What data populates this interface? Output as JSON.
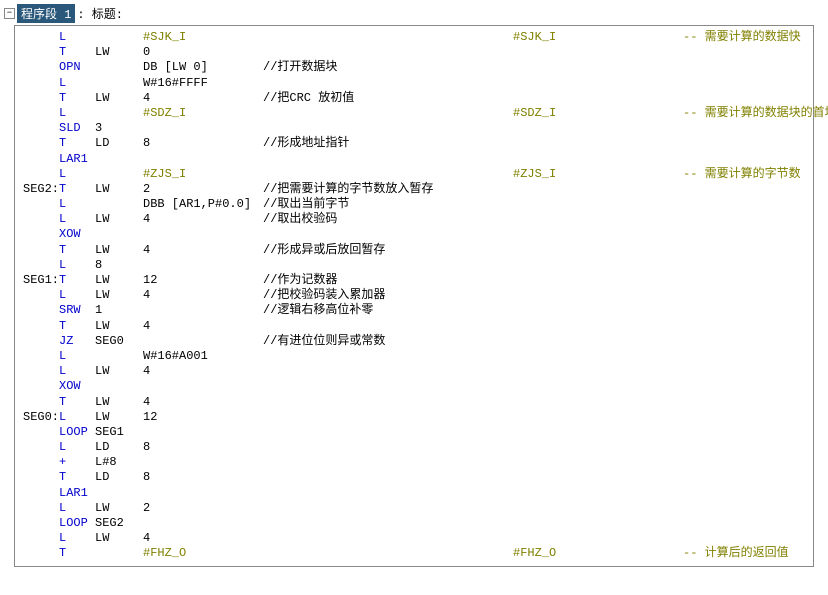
{
  "header": {
    "segment": "程序段 1",
    "title_label": ": 标题:"
  },
  "lines": [
    {
      "label": "",
      "op": "L",
      "arg1": "",
      "arg2": "#SJK_I",
      "argClass": "sharp",
      "comment": "",
      "refvar": "#SJK_I",
      "refcomment": "-- 需要计算的数据快"
    },
    {
      "label": "",
      "op": "T",
      "arg1": "LW",
      "arg2": "0",
      "comment": ""
    },
    {
      "label": "",
      "op": "OPN",
      "arg1": "",
      "arg2": "DB [LW 0]",
      "comment": "//打开数据块"
    },
    {
      "label": "",
      "op": "L",
      "arg1": "",
      "arg2": "W#16#FFFF",
      "comment": ""
    },
    {
      "label": "",
      "op": "T",
      "arg1": "LW",
      "arg2": "4",
      "comment": "//把CRC 放初值"
    },
    {
      "label": "",
      "op": "L",
      "arg1": "",
      "arg2": "#SDZ_I",
      "argClass": "sharp",
      "comment": "",
      "refvar": "#SDZ_I",
      "refcomment": "-- 需要计算的数据块的首地址"
    },
    {
      "label": "",
      "op": "SLD",
      "arg1": "3",
      "arg2": "",
      "comment": ""
    },
    {
      "label": "",
      "op": "T",
      "arg1": "LD",
      "arg2": "8",
      "comment": "//形成地址指针"
    },
    {
      "label": "",
      "op": "LAR1",
      "arg1": "",
      "arg2": "",
      "comment": ""
    },
    {
      "label": "",
      "op": "L",
      "arg1": "",
      "arg2": "#ZJS_I",
      "argClass": "sharp",
      "comment": "",
      "refvar": "#ZJS_I",
      "refcomment": "-- 需要计算的字节数"
    },
    {
      "label": "SEG2:",
      "op": "T",
      "arg1": "LW",
      "arg2": "2",
      "comment": "//把需要计算的字节数放入暂存"
    },
    {
      "label": "",
      "op": "L",
      "arg1": "",
      "arg2": "DBB [AR1,P#0.0]",
      "comment": "//取出当前字节"
    },
    {
      "label": "",
      "op": "L",
      "arg1": "LW",
      "arg2": "4",
      "comment": "//取出校验码"
    },
    {
      "label": "",
      "op": "XOW",
      "arg1": "",
      "arg2": "",
      "comment": ""
    },
    {
      "label": "",
      "op": "T",
      "arg1": "LW",
      "arg2": "4",
      "comment": "//形成异或后放回暂存"
    },
    {
      "label": "",
      "op": "L",
      "arg1": "8",
      "arg2": "",
      "comment": ""
    },
    {
      "label": "SEG1:",
      "op": "T",
      "arg1": "LW",
      "arg2": "12",
      "comment": "//作为记数器"
    },
    {
      "label": "",
      "op": "L",
      "arg1": "LW",
      "arg2": "4",
      "comment": "//把校验码装入累加器"
    },
    {
      "label": "",
      "op": "SRW",
      "arg1": "1",
      "arg2": "",
      "comment": "//逻辑右移高位补零"
    },
    {
      "label": "",
      "op": "T",
      "arg1": "LW",
      "arg2": "4",
      "comment": ""
    },
    {
      "label": "",
      "op": "JZ",
      "arg1": "SEG0",
      "arg2": "",
      "comment": "//有进位位则异或常数"
    },
    {
      "label": "",
      "op": "L",
      "arg1": "",
      "arg2": "W#16#A001",
      "comment": ""
    },
    {
      "label": "",
      "op": "L",
      "arg1": "LW",
      "arg2": "4",
      "comment": ""
    },
    {
      "label": "",
      "op": "XOW",
      "arg1": "",
      "arg2": "",
      "comment": ""
    },
    {
      "label": "",
      "op": "T",
      "arg1": "LW",
      "arg2": "4",
      "comment": ""
    },
    {
      "label": "SEG0:",
      "op": "L",
      "arg1": "LW",
      "arg2": "12",
      "comment": ""
    },
    {
      "label": "",
      "op": "LOOP",
      "arg1": "SEG1",
      "arg2": "",
      "comment": ""
    },
    {
      "label": "",
      "op": "L",
      "arg1": "LD",
      "arg2": "8",
      "comment": ""
    },
    {
      "label": "",
      "op": "+",
      "arg1": "L#8",
      "arg2": "",
      "comment": ""
    },
    {
      "label": "",
      "op": "T",
      "arg1": "LD",
      "arg2": "8",
      "comment": ""
    },
    {
      "label": "",
      "op": "LAR1",
      "arg1": "",
      "arg2": "",
      "comment": ""
    },
    {
      "label": "",
      "op": "L",
      "arg1": "LW",
      "arg2": "2",
      "comment": ""
    },
    {
      "label": "",
      "op": "LOOP",
      "arg1": "SEG2",
      "arg2": "",
      "comment": ""
    },
    {
      "label": "",
      "op": "L",
      "arg1": "LW",
      "arg2": "4",
      "comment": ""
    },
    {
      "label": "",
      "op": "T",
      "arg1": "",
      "arg2": "#FHZ_O",
      "argClass": "sharp",
      "comment": "",
      "refvar": "#FHZ_O",
      "refcomment": "-- 计算后的返回值"
    }
  ]
}
